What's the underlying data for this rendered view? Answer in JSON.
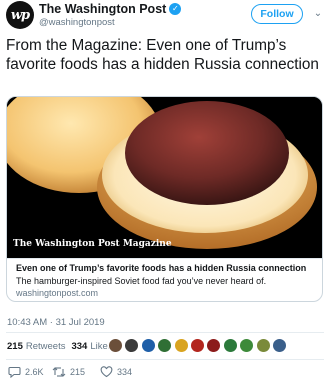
{
  "header": {
    "avatar_text": "wp",
    "display_name": "The Washington Post",
    "verified_glyph": "✓",
    "handle": "@washingtonpost",
    "follow_label": "Follow",
    "caret_glyph": "⌄"
  },
  "tweet": {
    "text": "From the Magazine: Even one of Trump’s favorite foods has a hidden Russia connection"
  },
  "card": {
    "overlay": "The Washington Post Magazine",
    "title": "Even one of Trump’s favorite foods has a hidden Russia connection",
    "description": "The hamburger-inspired Soviet food fad you’ve never heard of.",
    "domain": "washingtonpost.com"
  },
  "timestamp": "10:43 AM · 31 Jul 2019",
  "stats": {
    "retweets_count": "215",
    "retweets_label": "Retweets",
    "likes_count": "334",
    "likes_label": "Likes",
    "liker_avatar_colors": [
      "#6b4f3a",
      "#3b3b3b",
      "#1f5fa8",
      "#2f6f35",
      "#d9a420",
      "#b3261e",
      "#8c1b1b",
      "#2c7a3b",
      "#3d8a3a",
      "#7a8a3a",
      "#3a5f8a"
    ]
  },
  "actions": {
    "reply_count": "2.6K",
    "retweet_count": "215",
    "like_count": "334"
  },
  "colors": {
    "accent": "#1da1f2",
    "text": "#14171a",
    "muted": "#657786",
    "border": "#ccd6dd"
  }
}
